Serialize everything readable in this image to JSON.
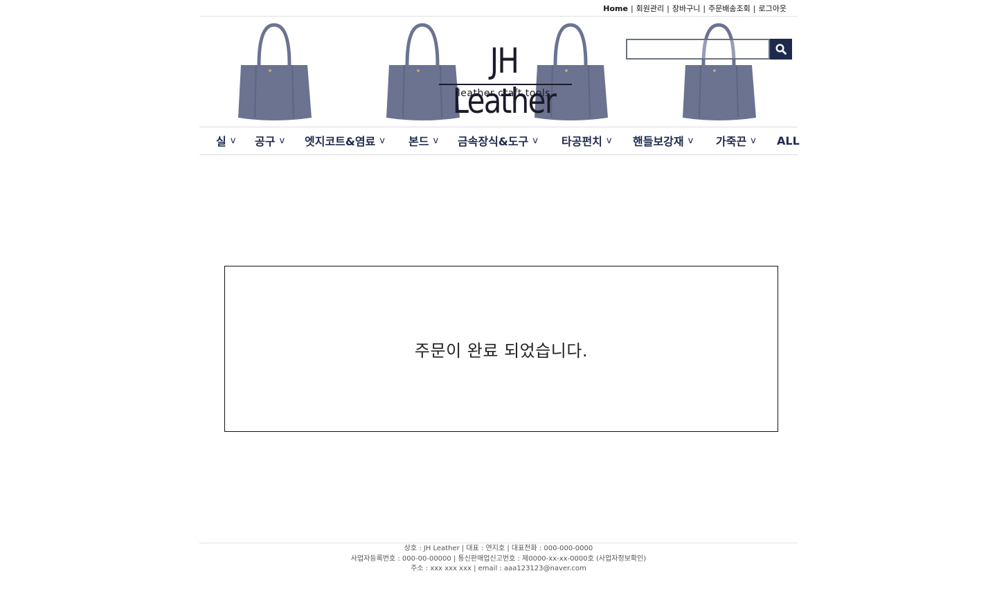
{
  "toplinks": [
    {
      "label": "Home"
    },
    {
      "label": "회원관리"
    },
    {
      "label": "장바구니"
    },
    {
      "label": "주문배송조회"
    },
    {
      "label": "로그아웃"
    }
  ],
  "logo": {
    "title": "JH Leather",
    "subtitle": "leather craft tools"
  },
  "search": {
    "placeholder": "",
    "value": "",
    "icon": "search-icon"
  },
  "nav": [
    {
      "label": "실",
      "chevron": "v"
    },
    {
      "label": "공구",
      "chevron": "v"
    },
    {
      "label": "엣지코트&염료",
      "chevron": "v"
    },
    {
      "label": "본드",
      "chevron": "v"
    },
    {
      "label": "금속장식&도구",
      "chevron": "v"
    },
    {
      "label": "타공펀치",
      "chevron": "v"
    },
    {
      "label": "핸들보강재",
      "chevron": "v"
    },
    {
      "label": "가죽끈",
      "chevron": "v"
    },
    {
      "label": "ALL",
      "chevron": ""
    }
  ],
  "message": "주문이 완료 되었습니다.",
  "footer": {
    "line1": "상호 : JH Leather | 대표 : 연지호 | 대표전화 : 000-000-0000",
    "line2": "사업자등록번호 : 000-00-00000 | 통신판매업신고번호 : 제0000-xx-xx-0000호 (사업자정보확인)",
    "line3": "주소 : xxx xxx xxx | email : aaa123123@naver.com"
  },
  "colors": {
    "accent": "#1d2a4d",
    "bag": "#6b7391"
  }
}
